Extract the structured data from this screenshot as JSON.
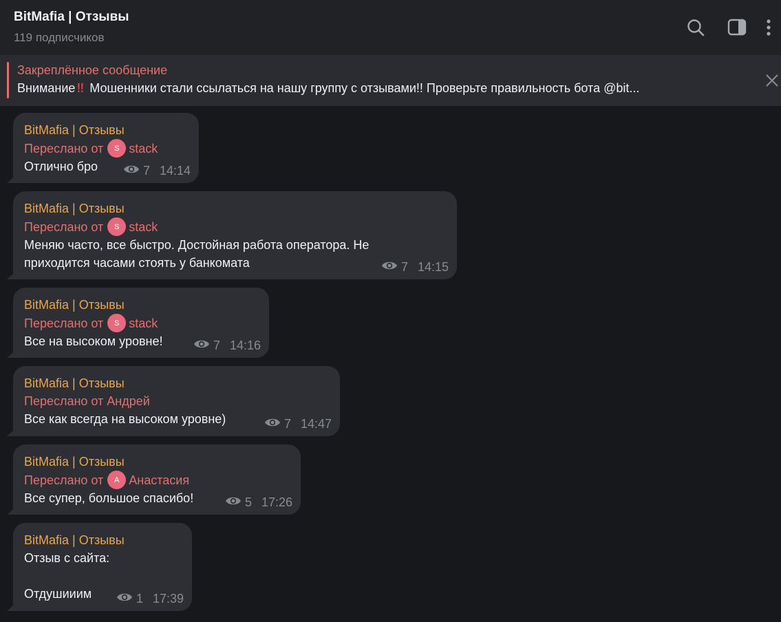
{
  "header": {
    "title": "BitMafia | Отзывы",
    "subtitle": "119 подписчиков",
    "icons": [
      "search-icon",
      "sidebar-toggle-icon",
      "more-vertical-icon"
    ]
  },
  "pinned": {
    "label": "Закреплённое сообщение",
    "text_before": "Внимание",
    "emoji": "‼",
    "text_after": "Мошенники стали ссылаться на нашу группу с отзывами!! Проверьте правильность бота @bit...",
    "accent": "#e46f6f"
  },
  "colors": {
    "author": "#e8a64e",
    "forward": "#e46f6f",
    "bubble": "#2d2f34",
    "meta": "#868b92"
  },
  "messages": [
    {
      "author": "BitMafia | Отзывы",
      "forward_prefix": "Переслано от",
      "forward_avatar": "S",
      "forward_name": "stack",
      "text": "Отлично бро",
      "views": "7",
      "time": "14:14"
    },
    {
      "author": "BitMafia | Отзывы",
      "forward_prefix": "Переслано от",
      "forward_avatar": "S",
      "forward_name": "stack",
      "text": "Меняю часто, все быстро. Достойная работа оператора. Не\nприходится часами стоять у банкомата",
      "views": "7",
      "time": "14:15"
    },
    {
      "author": "BitMafia | Отзывы",
      "forward_prefix": "Переслано от",
      "forward_avatar": "S",
      "forward_name": "stack",
      "text": "Все на высоком уровне!",
      "views": "7",
      "time": "14:16"
    },
    {
      "author": "BitMafia | Отзывы",
      "forward_prefix": "Переслано от",
      "forward_avatar": "",
      "forward_name": "Андрей",
      "text": "Все как всегда на высоком уровне)",
      "views": "7",
      "time": "14:47"
    },
    {
      "author": "BitMafia | Отзывы",
      "forward_prefix": "Переслано от",
      "forward_avatar": "A",
      "forward_name": "Анастасия",
      "text": "Все супер, большое спасибо!",
      "views": "5",
      "time": "17:26"
    },
    {
      "author": "BitMafia | Отзывы",
      "forward_prefix": "",
      "forward_avatar": "",
      "forward_name": "",
      "text": "Отзыв с сайта:\n\nОтдушииим",
      "views": "1",
      "time": "17:39"
    }
  ]
}
